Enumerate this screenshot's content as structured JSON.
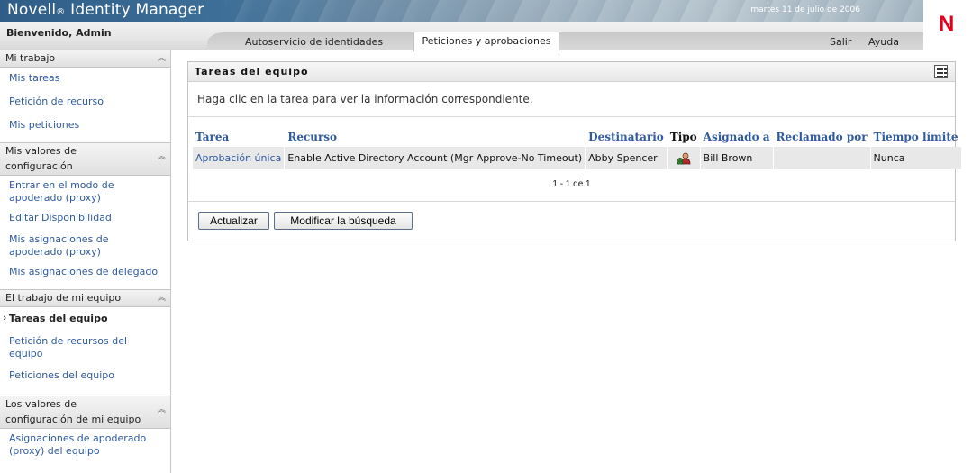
{
  "header": {
    "app_title": "Novell",
    "app_title_reg": "®",
    "app_title_rest": " Identity Manager",
    "date": "martes 11 de julio de 2006",
    "logo_letter": "N",
    "welcome": "Bienvenido, Admin",
    "tabs": [
      {
        "label": "Autoservicio de identidades",
        "active": false
      },
      {
        "label": "Peticiones y aprobaciones",
        "active": true
      }
    ],
    "links": {
      "logout": "Salir",
      "help": "Ayuda"
    }
  },
  "sidebar": {
    "sections": [
      {
        "title": "Mi trabajo",
        "items": [
          {
            "label": "Mis tareas"
          },
          {
            "label": "Petición de recurso"
          },
          {
            "label": "Mis peticiones"
          }
        ]
      },
      {
        "title_line1": "Mis valores de",
        "title_line2": "configuración",
        "items": [
          {
            "label": "Entrar en el modo de apoderado (proxy)"
          },
          {
            "label": "Editar Disponibilidad"
          },
          {
            "label": "Mis asignaciones de apoderado (proxy)"
          },
          {
            "label": "Mis asignaciones de delegado"
          }
        ]
      },
      {
        "title": "El trabajo de mi equipo",
        "items": [
          {
            "label": "Tareas del equipo",
            "current": true
          },
          {
            "label": "Petición de recursos del equipo"
          },
          {
            "label": "Peticiones del equipo"
          }
        ]
      },
      {
        "title_line1": "Los valores de",
        "title_line2": "configuración de mi equipo",
        "items": [
          {
            "label": "Asignaciones de apoderado (proxy) del equipo"
          }
        ]
      }
    ]
  },
  "panel": {
    "title": "Tareas del equipo",
    "instructions": "Haga clic en la tarea para ver la información correspondiente.",
    "columns": [
      "Tarea",
      "Recurso",
      "Destinatario",
      "Tipo",
      "Asignado a",
      "Reclamado por",
      "Tiempo límite"
    ],
    "rows": [
      {
        "task": "Aprobación única",
        "resource": "Enable Active Directory Account (Mgr Approve-No Timeout)",
        "recipient": "Abby Spencer",
        "type_icon": "user-group-icon",
        "assigned_to": "Bill Brown",
        "claimed_by": "",
        "deadline": "Nunca"
      }
    ],
    "pager": "1 - 1 de 1",
    "buttons": {
      "refresh": "Actualizar",
      "modify_search": "Modificar la búsqueda"
    }
  },
  "colors": {
    "link": "#2f5a9e",
    "brand_red": "#e2001a",
    "banner": "#3d6f98"
  }
}
